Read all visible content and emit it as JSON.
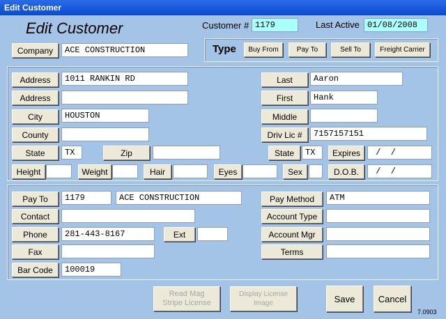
{
  "window": {
    "title": "Edit Customer"
  },
  "header": {
    "heading": "Edit Customer",
    "customer_num_label": "Customer #",
    "customer_num": "1179",
    "last_active_label": "Last Active",
    "last_active": "01/08/2008"
  },
  "company": {
    "label": "Company",
    "value": "ACE CONSTRUCTION"
  },
  "type": {
    "label": "Type",
    "buttons": [
      "Buy From",
      "Pay To",
      "Sell To",
      "Freight Carrier"
    ]
  },
  "address": {
    "address1_label": "Address",
    "address1": "1011 RANKIN RD",
    "address2_label": "Address",
    "address2": "",
    "city_label": "City",
    "city": "HOUSTON",
    "county_label": "County",
    "county": "",
    "state_label": "State",
    "state": "TX",
    "zip_label": "Zip",
    "zip": ""
  },
  "person": {
    "last_label": "Last",
    "last": "Aaron",
    "first_label": "First",
    "first": "Hank",
    "middle_label": "Middle",
    "middle": "",
    "driv_lic_label": "Driv Lic #",
    "driv_lic": "7157157151",
    "state_label": "State",
    "state": "TX",
    "expires_label": "Expires",
    "expires": " /  /",
    "height_label": "Height",
    "height": "",
    "weight_label": "Weight",
    "weight": "",
    "hair_label": "Hair",
    "hair": "",
    "eyes_label": "Eyes",
    "eyes": "",
    "sex_label": "Sex",
    "sex": "",
    "dob_label": "D.O.B.",
    "dob": " /  /"
  },
  "billing": {
    "pay_to_label": "Pay To",
    "pay_to_id": "1179",
    "pay_to_name": "ACE CONSTRUCTION",
    "contact_label": "Contact",
    "contact": "",
    "phone_label": "Phone",
    "phone": "281-443-8167",
    "ext_label": "Ext",
    "ext": "",
    "fax_label": "Fax",
    "fax": "",
    "bar_code_label": "Bar Code",
    "bar_code": "100019",
    "pay_method_label": "Pay Method",
    "pay_method": "ATM",
    "account_type_label": "Account Type",
    "account_type": "",
    "account_mgr_label": "Account Mgr",
    "account_mgr": "",
    "terms_label": "Terms",
    "terms": ""
  },
  "footer": {
    "read_mag_line1": "Read Mag",
    "read_mag_line2": "Stripe License",
    "display_license_line1": "Display License",
    "display_license_line2": "Image",
    "save_label": "Save",
    "cancel_label": "Cancel",
    "version": "7.0903"
  }
}
